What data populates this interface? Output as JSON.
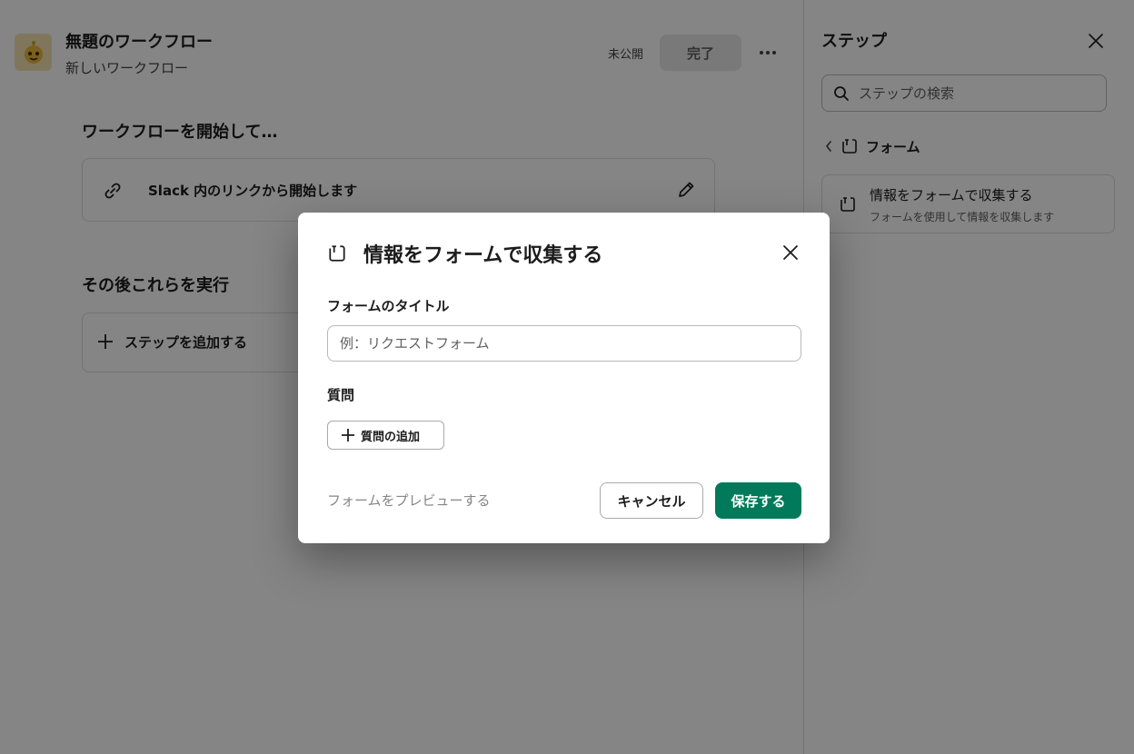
{
  "colors": {
    "accent": "#007a5a",
    "overlay": "rgba(0,0,0,0.48)",
    "avatar_bg": "#f3e3b0"
  },
  "workflow": {
    "title": "無題のワークフロー",
    "subtitle": "新しいワークフロー",
    "status": "未公開",
    "done_label": "完了",
    "more_icon": "more-horizontal-icon"
  },
  "main": {
    "start_heading": "ワークフローを開始して…",
    "trigger_label": "Slack 内のリンクから開始します",
    "then_heading": "その後これらを実行",
    "add_step_label": "ステップを追加する"
  },
  "panel": {
    "title": "ステップ",
    "search_placeholder": "ステップの検索",
    "breadcrumb_label": "フォーム",
    "step_item": {
      "title": "情報をフォームで収集する",
      "description": "フォームを使用して情報を収集します"
    }
  },
  "modal": {
    "title": "情報をフォームで収集する",
    "form_title_label": "フォームのタイトル",
    "form_title_placeholder": "例：リクエストフォーム",
    "form_title_value": "",
    "questions_label": "質問",
    "add_question_label": "質問の追加",
    "preview_label": "フォームをプレビューする",
    "cancel_label": "キャンセル",
    "save_label": "保存する"
  }
}
